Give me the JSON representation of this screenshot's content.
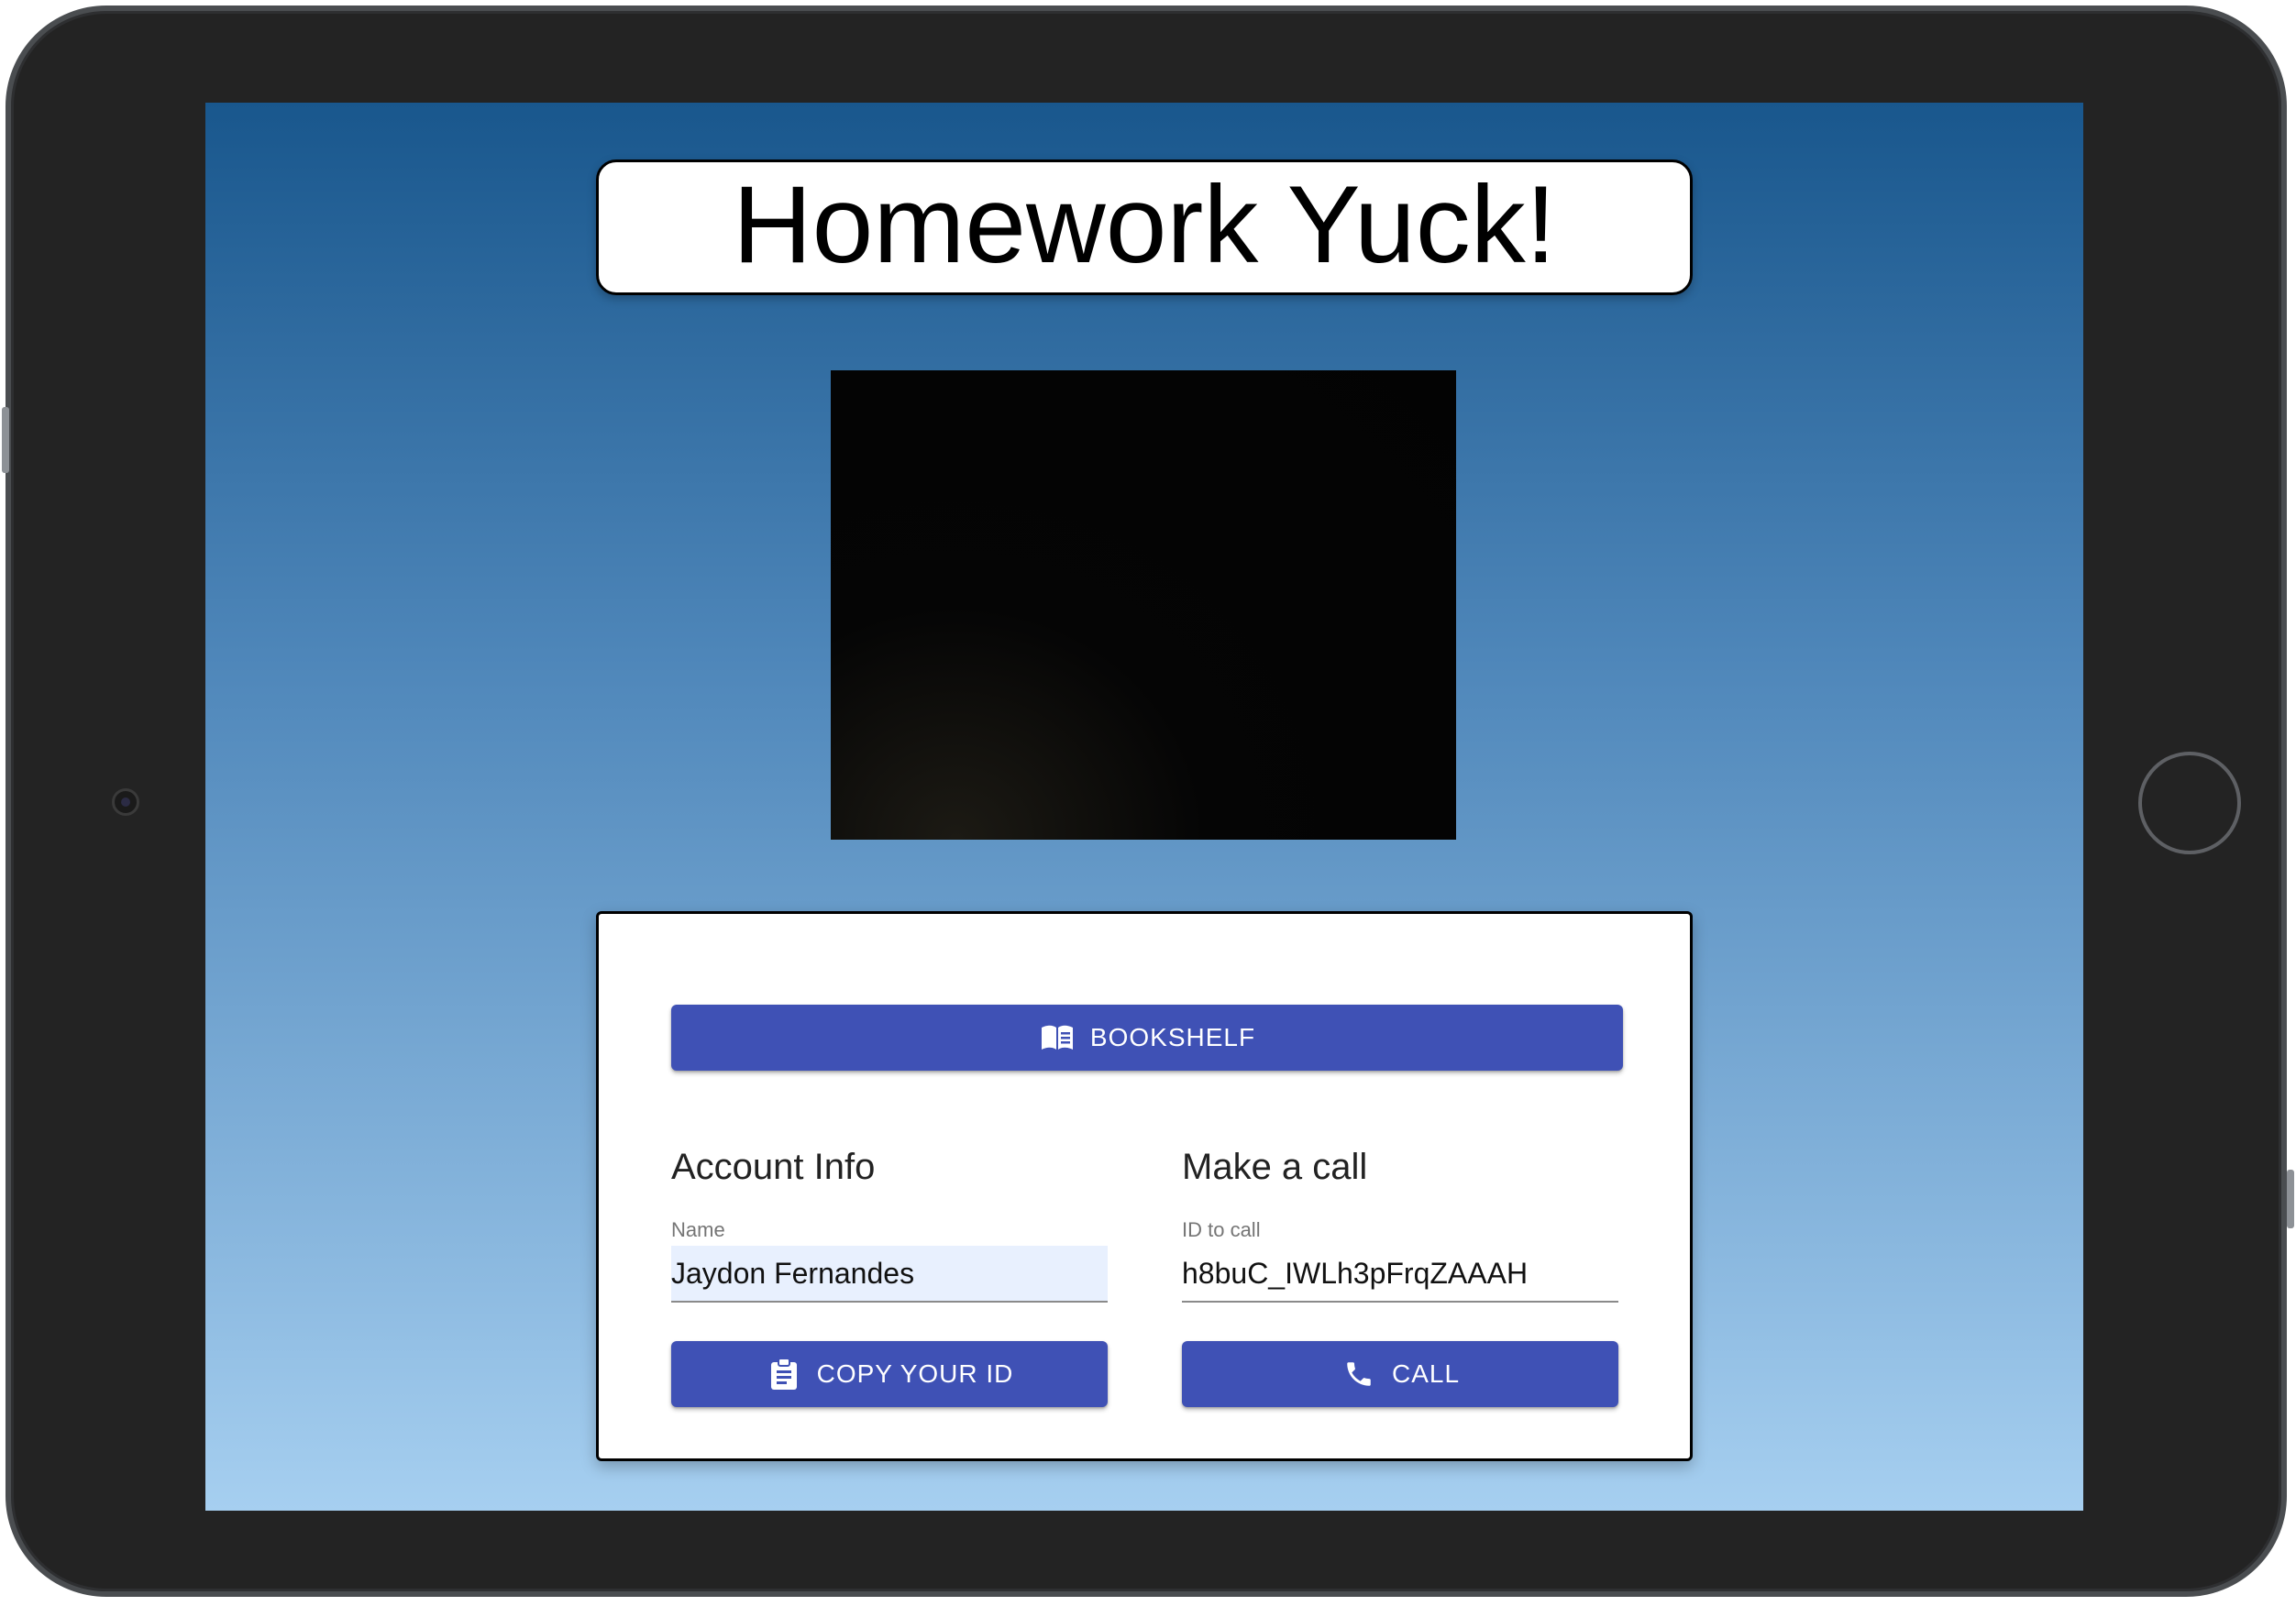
{
  "app": {
    "title": "Homework Yuck!"
  },
  "toolbar": {
    "bookshelf_label": "BOOKSHELF"
  },
  "account": {
    "section_title": "Account Info",
    "name_label": "Name",
    "name_value": "Jaydon Fernandes",
    "copy_id_label": "COPY YOUR ID"
  },
  "call": {
    "section_title": "Make a call",
    "id_label": "ID to call",
    "id_value": "h8buC_IWLh3pFrqZAAAH",
    "call_label": "CALL"
  },
  "colors": {
    "accent": "#3f51b5",
    "background_top": "#19578d",
    "background_bottom": "#a6cff0",
    "autofill": "#e8f0fe"
  },
  "icons": {
    "bookshelf": "book-open-icon",
    "copy": "clipboard-icon",
    "call": "phone-icon"
  }
}
